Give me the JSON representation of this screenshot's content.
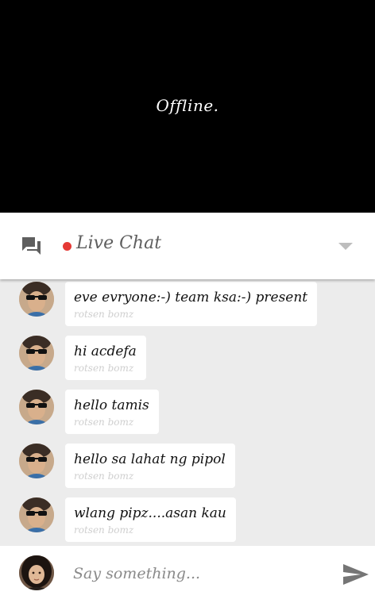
{
  "video": {
    "status": "Offline."
  },
  "chat_header": {
    "title": "Live Chat",
    "live_indicator_color": "#e53935",
    "chat_icon": "chat-bubbles-icon",
    "dropdown_icon": "dropdown-arrow-icon"
  },
  "messages": [
    {
      "text": "eve evryone:-) team ksa:-) present",
      "author": "rotsen bomz"
    },
    {
      "text": "hi acdefa",
      "author": "rotsen bomz"
    },
    {
      "text": "hello tamis",
      "author": "rotsen bomz"
    },
    {
      "text": "hello sa lahat ng pipol",
      "author": "rotsen bomz"
    },
    {
      "text": "wlang pipz....asan kau",
      "author": "rotsen bomz"
    }
  ],
  "composer": {
    "placeholder": "Say something...",
    "value": "",
    "send_icon": "send-icon"
  }
}
